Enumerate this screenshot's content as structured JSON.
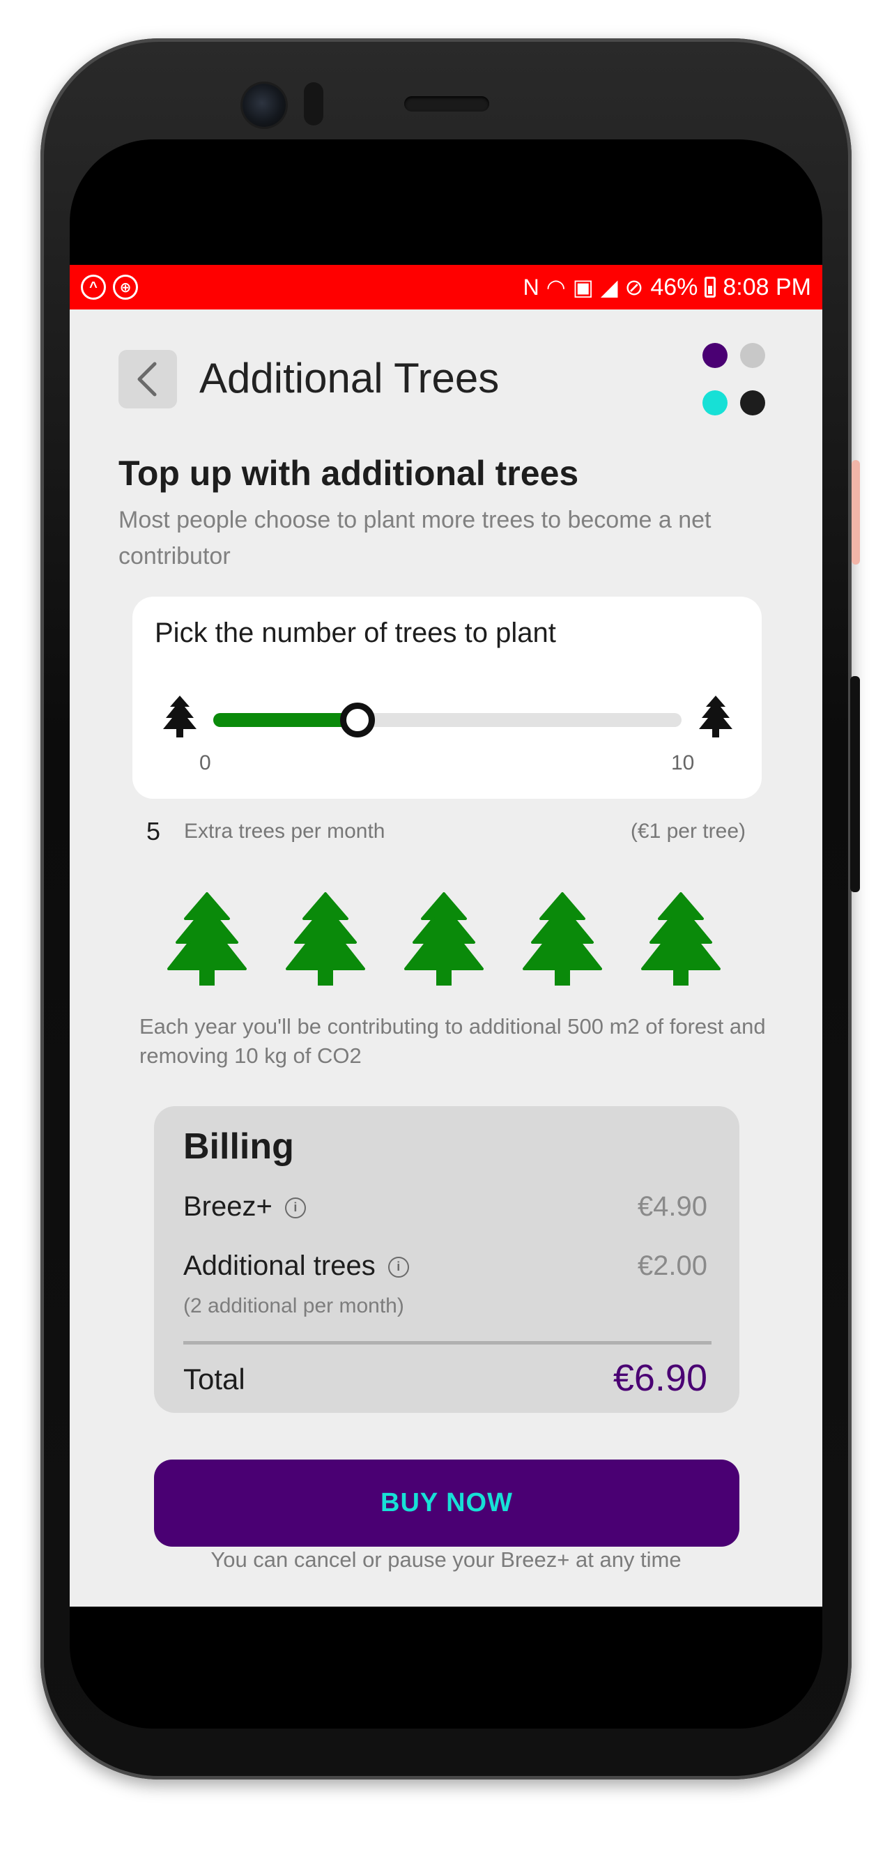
{
  "status_bar": {
    "battery": "46%",
    "time": "8:08 PM",
    "background": "#ff0000"
  },
  "header": {
    "title": "Additional Trees",
    "back_icon": "chevron-left-icon",
    "theme_dots": [
      "#4a0073",
      "#c8c8c8",
      "#17e0d6",
      "#1d1d1d"
    ]
  },
  "intro": {
    "title": "Top up with additional trees",
    "subtitle": "Most people choose to plant more trees to become a net contributor"
  },
  "slider": {
    "label": "Pick the number of trees to plant",
    "min": "0",
    "max": "10",
    "value_fraction": 0.3,
    "accent": "#0a8a0a"
  },
  "selection": {
    "count": "5",
    "label": "Extra trees per month",
    "price_per": "(€1 per tree)",
    "tree_icon": "pine-tree-icon",
    "tree_color": "#0a8a0a",
    "trees_shown": 5
  },
  "impact": {
    "text": "Each year you'll be contributing to additional 500 m2 of forest and removing 10 kg of CO2"
  },
  "billing": {
    "title": "Billing",
    "lines": [
      {
        "label": "Breez+",
        "amount": "€4.90"
      },
      {
        "label": "Additional trees",
        "amount": "€2.00",
        "sub": "(2 additional  per month)"
      }
    ],
    "total_label": "Total",
    "total_amount": "€6.90"
  },
  "cta": {
    "label": "BUY NOW",
    "note": "You can cancel or pause your Breez+ at any time",
    "background": "#4a0073",
    "text_color": "#17e0d6"
  }
}
